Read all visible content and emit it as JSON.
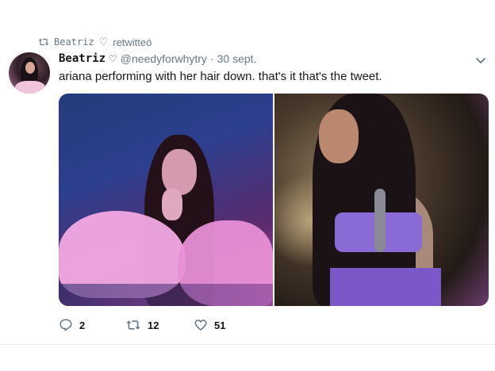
{
  "retweet_banner": {
    "name": "Beatriz",
    "heart": "♡",
    "text": "retwitteó"
  },
  "tweet": {
    "display_name": "Beatriz",
    "heart": "♡",
    "handle": "@needyforwhytry",
    "separator": "·",
    "date": "30 sept.",
    "text": "ariana performing with her hair down. that's it that's the tweet."
  },
  "actions": {
    "replies": "2",
    "retweets": "12",
    "likes": "51"
  },
  "icons": [
    "retweet-icon",
    "heart-icon",
    "chevron-down-icon",
    "reply-icon",
    "like-icon"
  ],
  "colors": {
    "secondary_text": "#657786",
    "primary_text": "#14171a"
  }
}
